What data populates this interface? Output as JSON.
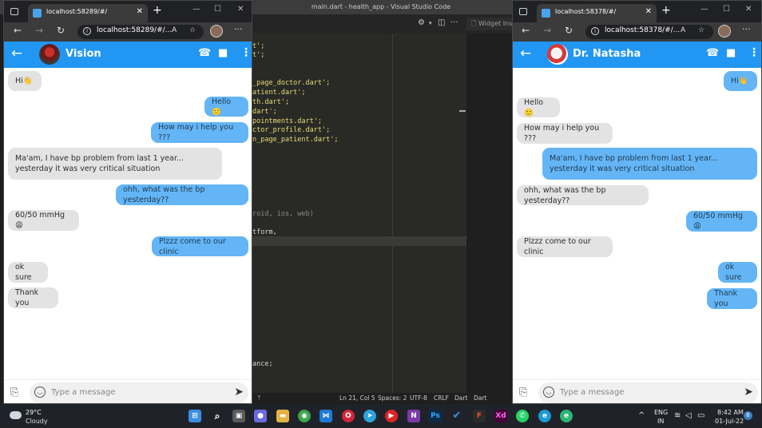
{
  "vscode": {
    "title": "main.dart - health_app - Visual Studio Code",
    "widget_tab": "Widget Ins",
    "code_lines": [
      {
        "text": "t';",
        "cls": ""
      },
      {
        "text": "t';",
        "cls": ""
      },
      {
        "text": "_page_doctor.dart';",
        "cls": ""
      },
      {
        "text": "atient.dart';",
        "cls": ""
      },
      {
        "text": "th.dart';",
        "cls": ""
      },
      {
        "text": "dart';",
        "cls": ""
      },
      {
        "text": "pointments.dart';",
        "cls": ""
      },
      {
        "text": "ctor_profile.dart';",
        "cls": ""
      },
      {
        "text": "n_page_patient.dart';",
        "cls": ""
      },
      {
        "text": "roid, ios, web)",
        "cls": "g"
      },
      {
        "text": "tform,",
        "cls": "w"
      },
      {
        "text": "ance;",
        "cls": "w"
      }
    ],
    "status": {
      "position": "Ln 21, Col 5",
      "spaces": "Spaces: 2",
      "encoding": "UTF-8",
      "eol": "CRLF",
      "language": "Dart",
      "devtools": "Dart DevTools"
    }
  },
  "left_window": {
    "tab_title": "localhost:58289/#/",
    "url": "localhost:58289/#/...",
    "contact_name": "Vision",
    "messages": [
      {
        "text": "Hi👋",
        "dir": "in"
      },
      {
        "text": "Hello 🙂",
        "dir": "out"
      },
      {
        "text": "How may i help you ???",
        "dir": "out"
      },
      {
        "text": "Ma'am, I have bp problem from last 1 year... yesterday it was very critical situation",
        "dir": "in"
      },
      {
        "text": "ohh, what was the bp yesterday??",
        "dir": "out"
      },
      {
        "text": "60/50 mmHg 😩",
        "dir": "in"
      },
      {
        "text": "Plzzz come to our clinic",
        "dir": "out"
      },
      {
        "text": "ok sure",
        "dir": "in"
      },
      {
        "text": "Thank you",
        "dir": "in"
      }
    ],
    "input_placeholder": "Type a message"
  },
  "right_window": {
    "tab_title": "localhost:58378/#/",
    "url": "localhost:58378/#/...",
    "contact_name": "Dr. Natasha",
    "messages": [
      {
        "text": "Hi👋",
        "dir": "out"
      },
      {
        "text": "Hello 🙂",
        "dir": "in"
      },
      {
        "text": "How may i help you ???",
        "dir": "in"
      },
      {
        "text": "Ma'am, I have bp problem from last 1 year... yesterday it was very critical situation",
        "dir": "out"
      },
      {
        "text": "ohh, what was the bp yesterday??",
        "dir": "in"
      },
      {
        "text": "60/50 mmHg 😩",
        "dir": "out"
      },
      {
        "text": "Plzzz come to our clinic",
        "dir": "in"
      },
      {
        "text": "ok sure",
        "dir": "out"
      },
      {
        "text": "Thank you",
        "dir": "out"
      }
    ],
    "input_placeholder": "Type a message"
  },
  "taskbar": {
    "weather_temp": "29°C",
    "weather_desc": "Cloudy",
    "lang_top": "ENG",
    "lang_bottom": "IN",
    "time": "8:42 AM",
    "date": "01-Jul-22",
    "notification_count": "6"
  },
  "colors": {
    "app_bar": "#2196f3",
    "outgoing_bubble": "#64b5f6",
    "incoming_bubble": "#e3e3e3",
    "browser_chrome": "#202124",
    "editor_bg": "#292a26",
    "taskbar_bg": "#1f2329"
  }
}
